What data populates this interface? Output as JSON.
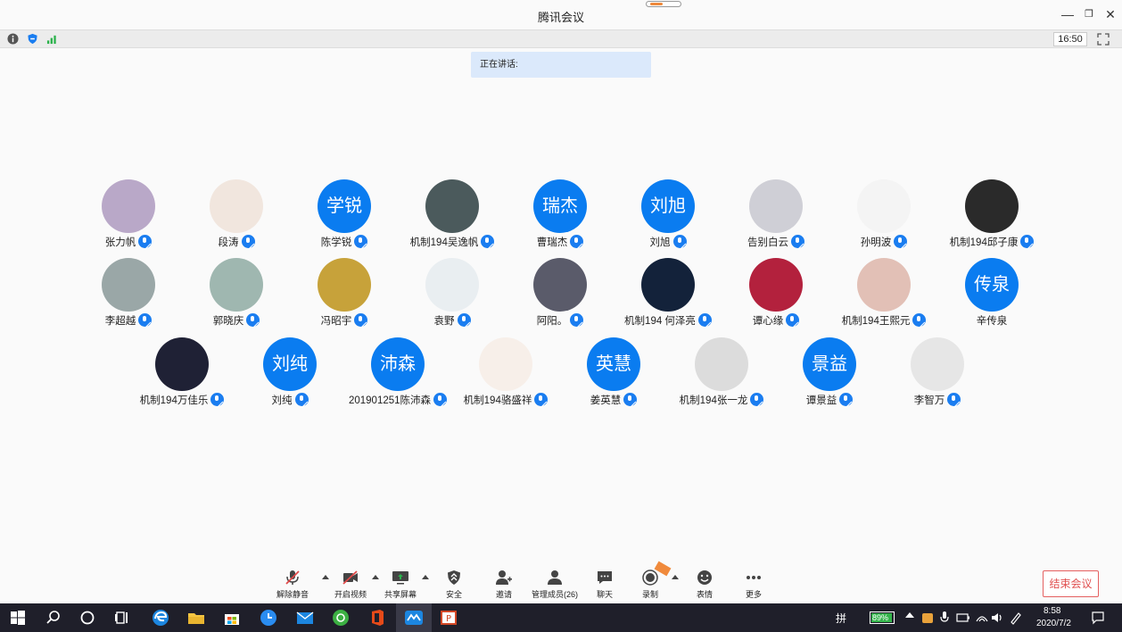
{
  "window": {
    "title": "腾讯会议"
  },
  "infobar": {
    "time": "16:50"
  },
  "speaking": {
    "label": "正在讲话:"
  },
  "participants": [
    {
      "name": "张力帆",
      "avatar_text": "",
      "color": "#b9a8c8"
    },
    {
      "name": "段涛",
      "avatar_text": "",
      "color": "#f1e6de"
    },
    {
      "name": "陈学锐",
      "avatar_text": "学锐",
      "color": "#0a7cf0"
    },
    {
      "name": "机制194吴逸帆",
      "avatar_text": "",
      "color": "#4b5a5c"
    },
    {
      "name": "曹瑞杰",
      "avatar_text": "瑞杰",
      "color": "#0a7cf0"
    },
    {
      "name": "刘旭",
      "avatar_text": "刘旭",
      "color": "#0a7cf0"
    },
    {
      "name": "告别白云",
      "avatar_text": "",
      "color": "#cfcfd6"
    },
    {
      "name": "孙明波",
      "avatar_text": "",
      "color": "#f4f4f4"
    },
    {
      "name": "机制194邱子康",
      "avatar_text": "",
      "color": "#2a2a2a"
    },
    {
      "name": "李超越",
      "avatar_text": "",
      "color": "#9aa7a7"
    },
    {
      "name": "郭晓庆",
      "avatar_text": "",
      "color": "#9fb7b0"
    },
    {
      "name": "冯昭宇",
      "avatar_text": "",
      "color": "#c7a23a"
    },
    {
      "name": "袁野",
      "avatar_text": "",
      "color": "#e9eef1"
    },
    {
      "name": "阿阳。",
      "avatar_text": "",
      "color": "#5a5b6a"
    },
    {
      "name": "机制194 何泽亮",
      "avatar_text": "",
      "color": "#13223a"
    },
    {
      "name": "谭心缘",
      "avatar_text": "",
      "color": "#b3213d"
    },
    {
      "name": "机制194王熙元",
      "avatar_text": "",
      "color": "#e2c0b6"
    },
    {
      "name": "辛传泉",
      "avatar_text": "传泉",
      "color": "#0a7cf0",
      "no_mic": true
    },
    {
      "name": "机制194万佳乐",
      "avatar_text": "",
      "color": "#1f2135"
    },
    {
      "name": "刘纯",
      "avatar_text": "刘纯",
      "color": "#0a7cf0"
    },
    {
      "name": "201901251陈沛森",
      "avatar_text": "沛森",
      "color": "#0a7cf0"
    },
    {
      "name": "机制194骆盛祥",
      "avatar_text": "",
      "color": "#f7efe9"
    },
    {
      "name": "姜英慧",
      "avatar_text": "英慧",
      "color": "#0a7cf0"
    },
    {
      "name": "机制194张一龙",
      "avatar_text": "",
      "color": "#dcdcdc"
    },
    {
      "name": "谭景益",
      "avatar_text": "景益",
      "color": "#0a7cf0"
    },
    {
      "name": "李智万",
      "avatar_text": "",
      "color": "#e6e6e6"
    }
  ],
  "toolbar": {
    "unmute": "解除静音",
    "video": "开启视频",
    "share": "共享屏幕",
    "security": "安全",
    "invite": "邀请",
    "members": "管理成员(26)",
    "chat": "聊天",
    "record": "录制",
    "emoji": "表情",
    "more": "更多",
    "end": "结束会议"
  },
  "taskbar": {
    "ime": "拼",
    "battery": "89%",
    "clock_time": "8:58",
    "clock_date": "2020/7/2"
  }
}
